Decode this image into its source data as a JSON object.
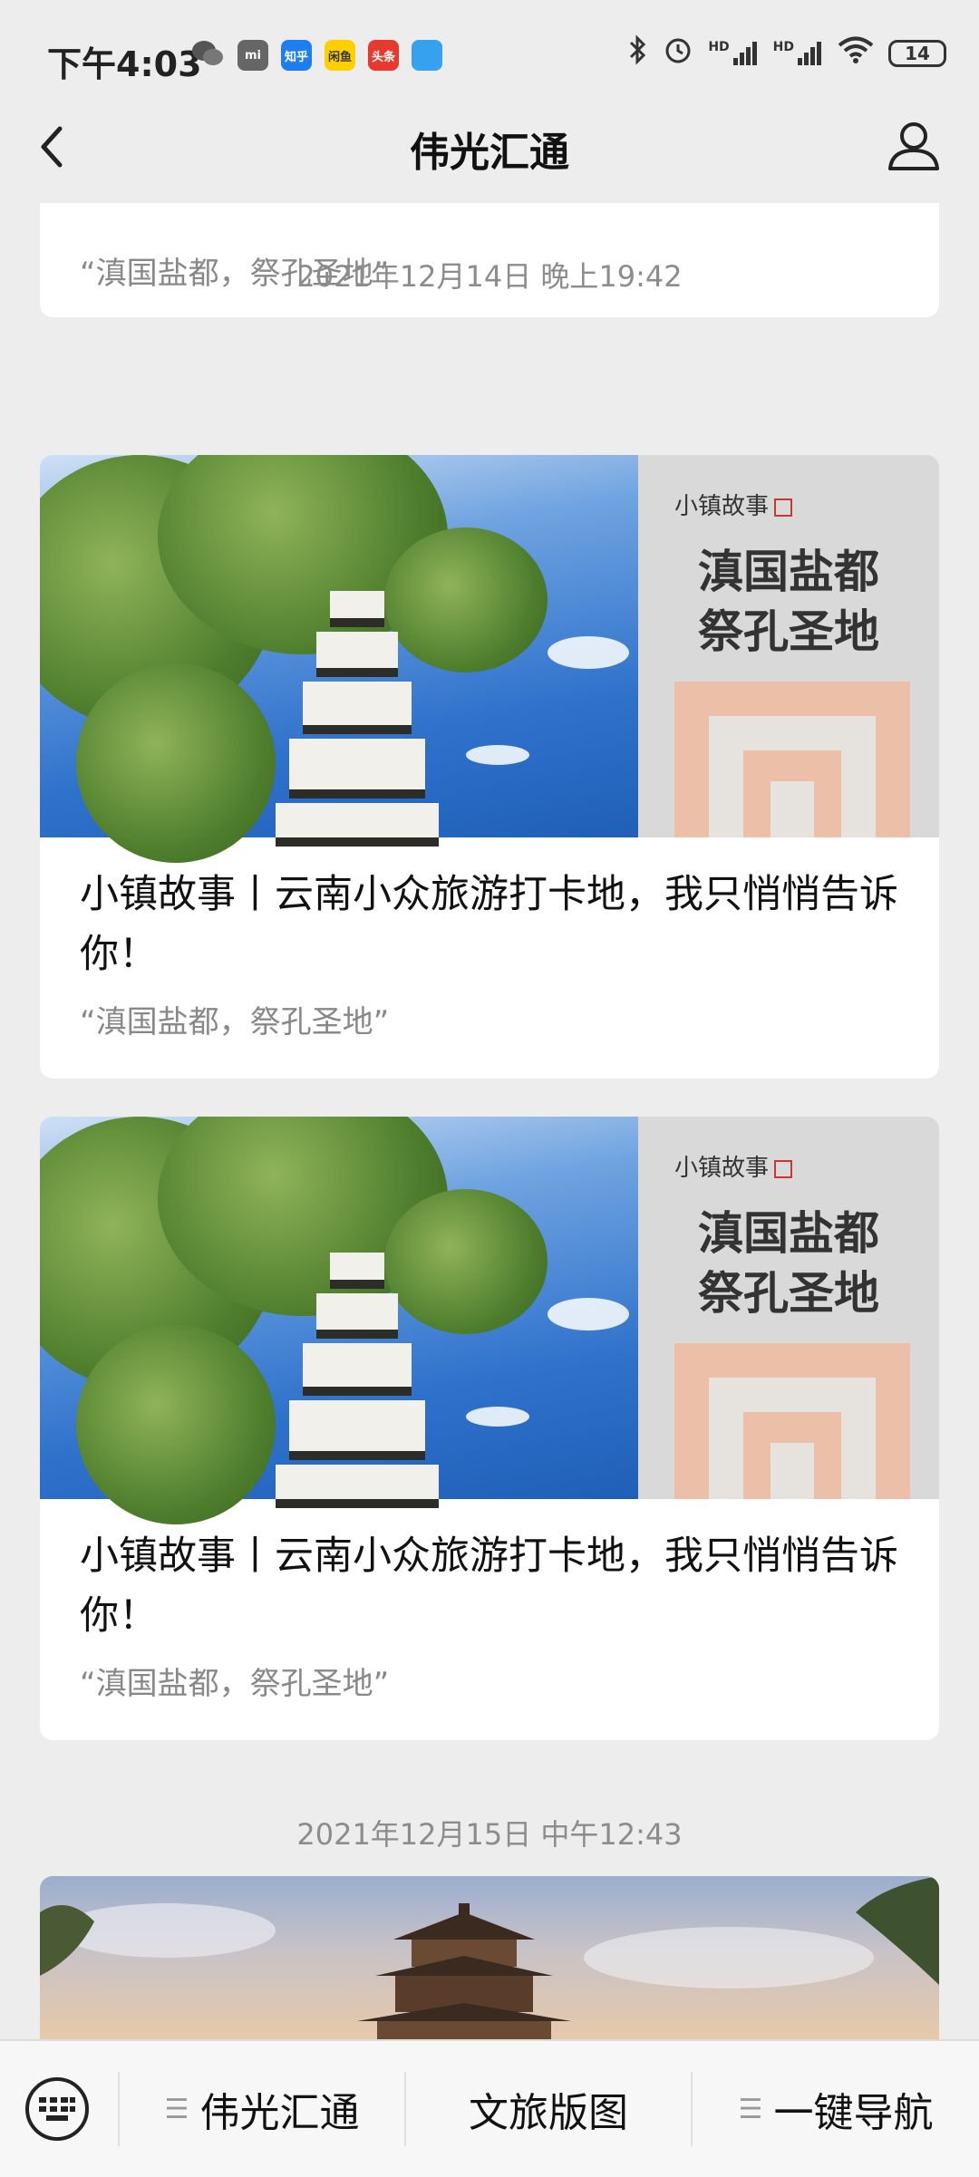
{
  "status_bar": {
    "time": "下午4:03",
    "app_icons": [
      "WeChat",
      "Xiaomi",
      "知乎",
      "闲鱼",
      "头条",
      "App"
    ],
    "app_labels": [
      "mi",
      "知乎",
      "闲鱼",
      "头条"
    ],
    "signal_label_1": "HD",
    "signal_label_2": "HD",
    "battery": "14"
  },
  "header": {
    "title": "伟光汇通"
  },
  "feed": {
    "partial_top_digest": "“滇国盐都，祭孔圣地”",
    "date_1": "2021年12月14日 晚上19:42",
    "articles": [
      {
        "cover_sub": "小镇故事",
        "cover_big_1": "滇国盐都",
        "cover_big_2": "祭孔圣地",
        "title": "小镇故事丨云南小众旅游打卡地，我只悄悄告诉你！",
        "digest": "“滇国盐都，祭孔圣地”"
      },
      {
        "cover_sub": "小镇故事",
        "cover_big_1": "滇国盐都",
        "cover_big_2": "祭孔圣地",
        "title": "小镇故事丨云南小众旅游打卡地，我只悄悄告诉你！",
        "digest": "“滇国盐都，祭孔圣地”"
      }
    ],
    "date_2": "2021年12月15日 中午12:43"
  },
  "menu": {
    "items": [
      {
        "label": "伟光汇通",
        "has_submenu": true
      },
      {
        "label": "文旅版图",
        "has_submenu": false
      },
      {
        "label": "一键导航",
        "has_submenu": true
      }
    ]
  },
  "colors": {
    "background": "#ededed",
    "card": "#ffffff",
    "muted_text": "#888888",
    "accent_deco": "#ecc0a8"
  }
}
